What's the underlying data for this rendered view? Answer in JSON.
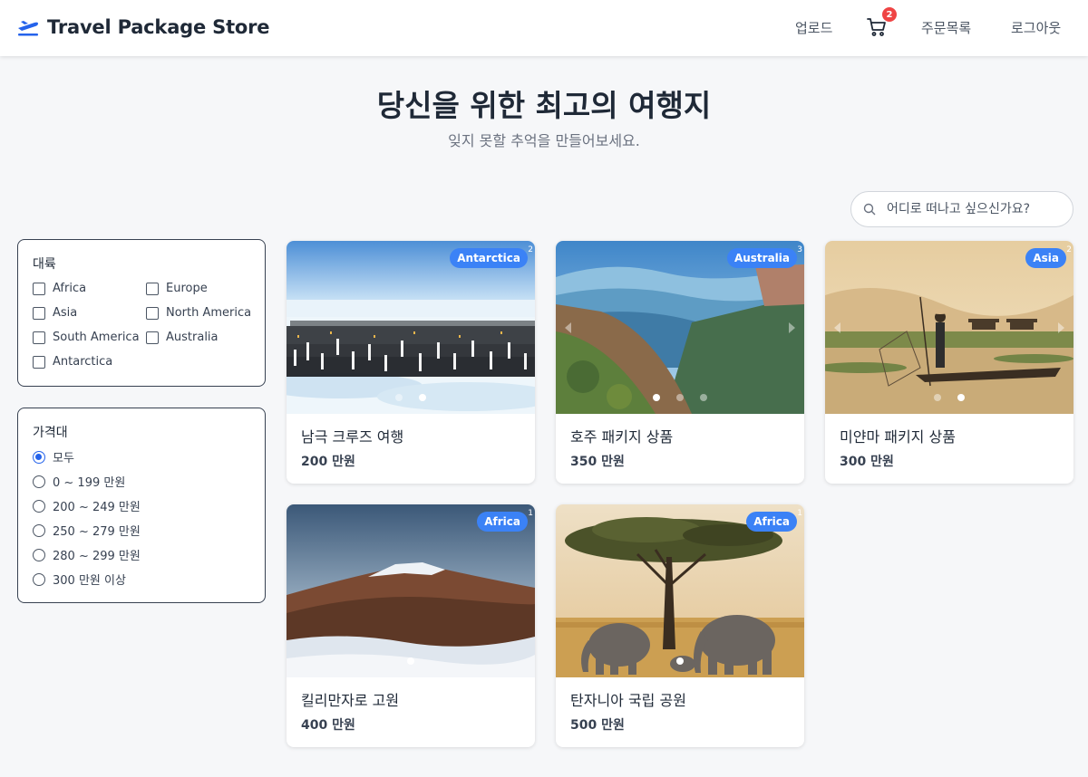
{
  "header": {
    "brand": "Travel Package Store",
    "nav": {
      "upload": "업로드",
      "orders": "주문목록",
      "logout": "로그아웃"
    },
    "cart_count": "2"
  },
  "hero": {
    "title": "당신을 위한 최고의 여행지",
    "subtitle": "잊지 못할 추억을 만들어보세요."
  },
  "search": {
    "placeholder": "어디로 떠나고 싶으신가요?"
  },
  "filters": {
    "continent": {
      "title": "대륙",
      "options": [
        "Africa",
        "Europe",
        "Asia",
        "North America",
        "South America",
        "Australia",
        "Antarctica"
      ]
    },
    "price": {
      "title": "가격대",
      "options": [
        "모두",
        "0 ~ 199 만원",
        "200 ~ 249 만원",
        "250 ~ 279 만원",
        "280 ~ 299 만원",
        "300 만원 이상"
      ],
      "selected": "모두"
    }
  },
  "products": [
    {
      "name": "남극 크루즈 여행",
      "price": "200 만원",
      "continent": "Antarctica",
      "image_count": "2",
      "image": "penguins-icon"
    },
    {
      "name": "호주 패키지 상품",
      "price": "350 만원",
      "continent": "Australia",
      "image_count": "3",
      "image": "mountain-valley-icon"
    },
    {
      "name": "미얀마 패키지 상품",
      "price": "300 만원",
      "continent": "Asia",
      "image_count": "2",
      "image": "fisherman-boat-icon"
    },
    {
      "name": "킬리만자로 고원",
      "price": "400 만원",
      "continent": "Africa",
      "image_count": "1",
      "image": "snow-mountain-icon"
    },
    {
      "name": "탄자니아 국립 공원",
      "price": "500 만원",
      "continent": "Africa",
      "image_count": "1",
      "image": "elephants-tree-icon"
    }
  ],
  "colors": {
    "accent": "#3b82f6",
    "badge_red": "#ef4444",
    "brand_icon": "#2563eb"
  }
}
